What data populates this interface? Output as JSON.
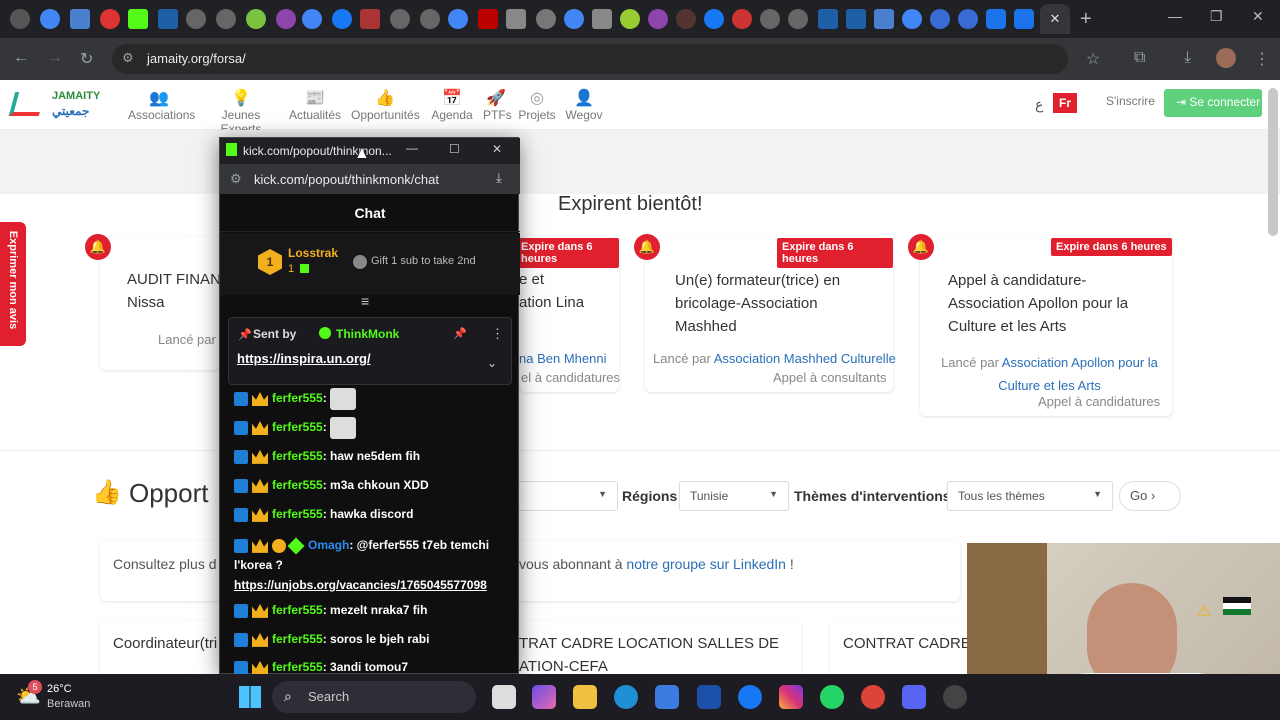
{
  "browser": {
    "url": "jamaity.org/forsa/"
  },
  "site": {
    "nav": [
      {
        "label": "Associations"
      },
      {
        "label": "Jeunes Experts"
      },
      {
        "label": "Actualités"
      },
      {
        "label": "Opportunités"
      },
      {
        "label": "Agenda"
      },
      {
        "label": "PTFs"
      },
      {
        "label": "Projets"
      },
      {
        "label": "Wegov"
      }
    ],
    "lang_ar": "ع",
    "lang_fr": "Fr",
    "inscrire": "S'inscrire",
    "connect": "Se connecter",
    "section_title": "Expirent bientôt!",
    "feedback": "Exprimer mon avis",
    "cards": [
      {
        "title": "AUDIT FINAN\nNissa",
        "lance": "Lancé par A"
      },
      {
        "badge": "Expire dans 6 heures",
        "title": "e et\nation Lina",
        "lance": "na Ben Mhenni",
        "type": "el à candidatures"
      },
      {
        "badge": "Expire dans 6 heures",
        "title": "Un(e) formateur(trice) en bricolage-Association Mashhed",
        "lance_pre": "Lancé par ",
        "lance": "Association Mashhed Culturelle",
        "type": "Appel à consultants"
      },
      {
        "badge": "Expire dans 6 heures",
        "title": "Appel à candidature-Association Apollon pour la Culture et les Arts",
        "lance_pre": "Lancé par ",
        "lance": "Association Apollon pour la Culture et les Arts",
        "type": "Appel à candidatures"
      }
    ],
    "opport": "Opport",
    "regions_label": "Régions",
    "regions_val": "Tunisie",
    "themes_label": "Thèmes d'interventions",
    "themes_val": "Tous les thèmes",
    "go": "Go",
    "consultez": "Consultez plus d",
    "linkedin_pre": "vous abonnant à ",
    "linkedin_link": "notre groupe sur LinkedIn",
    "linkedin_post": " !",
    "bottom_cards": [
      "Coordinateur(tri",
      "TRAT CADRE LOCATION SALLES DE\nATION-CEFA",
      "CONTRAT CADRE"
    ]
  },
  "popup": {
    "title": "kick.com/popout/thinkmon...",
    "url": "kick.com/popout/thinkmonk/chat",
    "header": "Chat",
    "top_user": "Losstrak",
    "top_num": "1",
    "gift": "Gift 1 sub to take 2nd",
    "pinned_by": "Sent by",
    "pinned_user": "ThinkMonk",
    "pinned_link": "https://inspira.un.org/",
    "messages": [
      {
        "user": "ferfer555",
        "text": ":",
        "cat": true
      },
      {
        "user": "ferfer555",
        "text": ":",
        "cat": true
      },
      {
        "user": "ferfer555",
        "text": ": haw ne5dem fih"
      },
      {
        "user": "ferfer555",
        "text": ": m3a chkoun XDD"
      },
      {
        "user": "ferfer555",
        "text": ": hawka discord"
      },
      {
        "user": "Omagh",
        "text": ": @ferfer555 t7eb temchi l'korea ?",
        "link": "https://unjobs.org/vacancies/1765045577098"
      },
      {
        "user": "ferfer555",
        "text": ": mezelt nraka7 fih"
      },
      {
        "user": "ferfer555",
        "text": ": soros le bjeh rabi"
      },
      {
        "user": "ferfer555",
        "text": ": 3andi tomou7"
      }
    ]
  },
  "taskbar": {
    "temp": "26°C",
    "weather": "Berawan",
    "search": "Search",
    "notif": "5"
  }
}
